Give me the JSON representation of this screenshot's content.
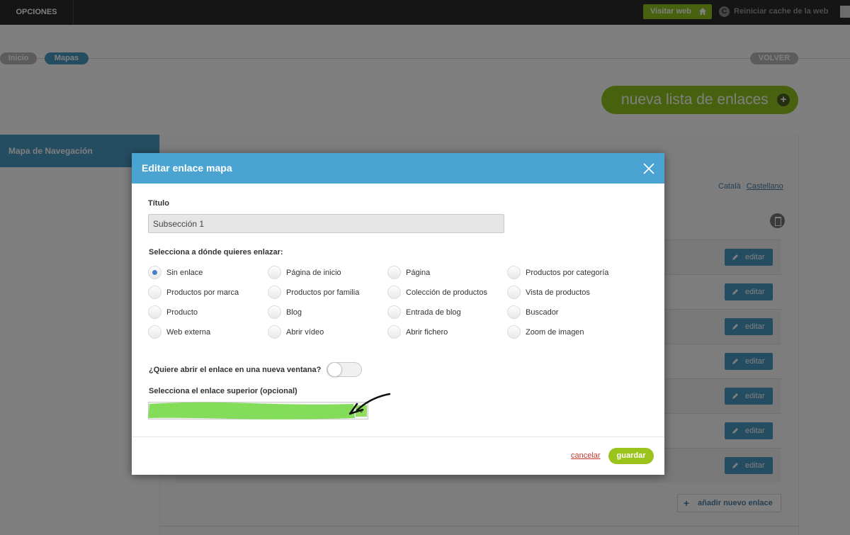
{
  "topbar": {
    "options_label": "OPCIONES",
    "visit_label": "Visitar web",
    "visit_icon": "home-icon",
    "reset_icon_glyph": "C",
    "reset_label": "Reiniciar cache de la web"
  },
  "breadcrumb": {
    "home": "Inicio",
    "current": "Mapas",
    "back": "VOLVER"
  },
  "new_list_button": {
    "label": "nueva lista de enlaces",
    "icon": "+"
  },
  "sidebar": {
    "items": [
      {
        "label": "Mapa de Navegación"
      }
    ]
  },
  "languages": [
    "Català",
    "Castellano"
  ],
  "table": {
    "edit_label": "editar",
    "rows": [
      {},
      {},
      {},
      {},
      {},
      {},
      {}
    ],
    "add_link_icon": "+",
    "add_link_label": "añadir nuevo enlace"
  },
  "modal": {
    "title": "Editar enlace mapa",
    "title_field_label": "Título",
    "title_value": "Subsección 1",
    "link_target_label": "Selecciona a dónde quieres enlazar:",
    "link_options": [
      "Sin enlace",
      "Página de inicio",
      "Página",
      "Productos por categoría",
      "Productos por marca",
      "Productos por familia",
      "Colección de productos",
      "Vista de productos",
      "Producto",
      "Blog",
      "Entrada de blog",
      "Buscador",
      "Web externa",
      "Abrir vídeo",
      "Abrir fichero",
      "Zoom de imagen"
    ],
    "selected_option": "Sin enlace",
    "new_window_label": "¿Quiere abrir el enlace en una nueva ventana?",
    "new_window_enabled": false,
    "parent_link_label": "Selecciona el enlace superior (opcional)",
    "cancel_label": "cancelar",
    "save_label": "guardar"
  },
  "colors": {
    "topbar": "#2b2b2b",
    "accent_blue": "#4b9ac4",
    "modal_header": "#4ba3d1",
    "green": "#8fc21f",
    "highlight_green": "#84dd5a"
  }
}
